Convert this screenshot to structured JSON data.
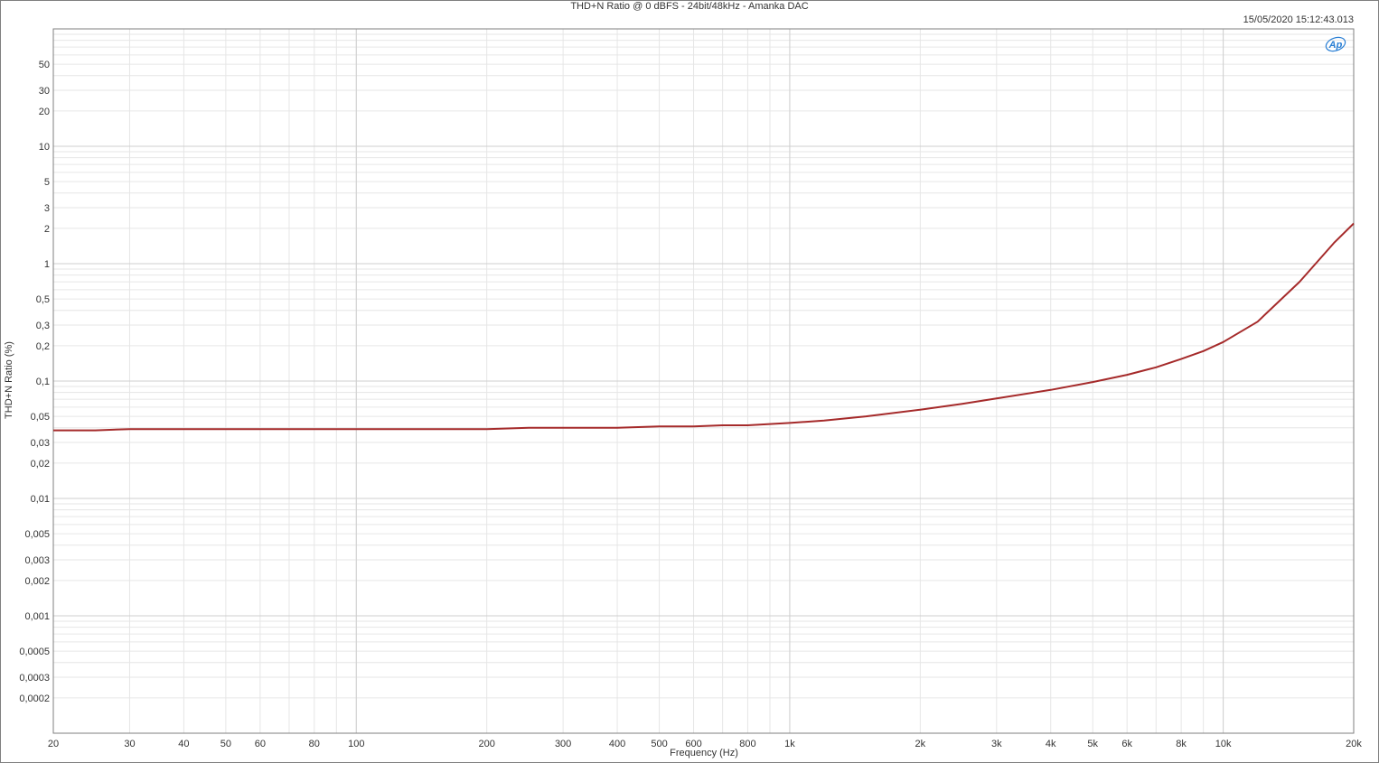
{
  "chart_data": {
    "type": "line",
    "title": "THD+N Ratio @ 0 dBFS - 24bit/48kHz - Amanka DAC",
    "timestamp": "15/05/2020 15:12:43.013",
    "logo": "AP",
    "xlabel": "Frequency (Hz)",
    "ylabel": "THD+N Ratio (%)",
    "x_scale": "log",
    "y_scale": "log",
    "xlim": [
      20,
      20000
    ],
    "ylim": [
      0.0001,
      100
    ],
    "grid": true,
    "x_ticks": [
      {
        "v": 20,
        "label": "20"
      },
      {
        "v": 30,
        "label": "30"
      },
      {
        "v": 40,
        "label": "40"
      },
      {
        "v": 50,
        "label": "50"
      },
      {
        "v": 60,
        "label": "60"
      },
      {
        "v": 80,
        "label": "80"
      },
      {
        "v": 100,
        "label": "100"
      },
      {
        "v": 200,
        "label": "200"
      },
      {
        "v": 300,
        "label": "300"
      },
      {
        "v": 400,
        "label": "400"
      },
      {
        "v": 500,
        "label": "500"
      },
      {
        "v": 600,
        "label": "600"
      },
      {
        "v": 800,
        "label": "800"
      },
      {
        "v": 1000,
        "label": "1k"
      },
      {
        "v": 2000,
        "label": "2k"
      },
      {
        "v": 3000,
        "label": "3k"
      },
      {
        "v": 4000,
        "label": "4k"
      },
      {
        "v": 5000,
        "label": "5k"
      },
      {
        "v": 6000,
        "label": "6k"
      },
      {
        "v": 8000,
        "label": "8k"
      },
      {
        "v": 10000,
        "label": "10k"
      },
      {
        "v": 20000,
        "label": "20k"
      }
    ],
    "y_ticks": [
      {
        "v": 50,
        "label": "50"
      },
      {
        "v": 30,
        "label": "30"
      },
      {
        "v": 20,
        "label": "20"
      },
      {
        "v": 10,
        "label": "10"
      },
      {
        "v": 5,
        "label": "5"
      },
      {
        "v": 3,
        "label": "3"
      },
      {
        "v": 2,
        "label": "2"
      },
      {
        "v": 1,
        "label": "1"
      },
      {
        "v": 0.5,
        "label": "0,5"
      },
      {
        "v": 0.3,
        "label": "0,3"
      },
      {
        "v": 0.2,
        "label": "0,2"
      },
      {
        "v": 0.1,
        "label": "0,1"
      },
      {
        "v": 0.05,
        "label": "0,05"
      },
      {
        "v": 0.03,
        "label": "0,03"
      },
      {
        "v": 0.02,
        "label": "0,02"
      },
      {
        "v": 0.01,
        "label": "0,01"
      },
      {
        "v": 0.005,
        "label": "0,005"
      },
      {
        "v": 0.003,
        "label": "0,003"
      },
      {
        "v": 0.002,
        "label": "0,002"
      },
      {
        "v": 0.001,
        "label": "0,001"
      },
      {
        "v": 0.0005,
        "label": "0,0005"
      },
      {
        "v": 0.0003,
        "label": "0,0003"
      },
      {
        "v": 0.0002,
        "label": "0,0002"
      }
    ],
    "series": [
      {
        "color": "#a52a2a",
        "x": [
          20,
          25,
          30,
          40,
          50,
          60,
          70,
          80,
          100,
          120,
          150,
          200,
          250,
          300,
          400,
          500,
          600,
          700,
          800,
          1000,
          1200,
          1500,
          2000,
          2500,
          3000,
          4000,
          5000,
          6000,
          7000,
          8000,
          9000,
          10000,
          12000,
          15000,
          18000,
          20000
        ],
        "y": [
          0.038,
          0.038,
          0.039,
          0.039,
          0.039,
          0.039,
          0.039,
          0.039,
          0.039,
          0.039,
          0.039,
          0.039,
          0.04,
          0.04,
          0.04,
          0.041,
          0.041,
          0.042,
          0.042,
          0.044,
          0.046,
          0.05,
          0.057,
          0.064,
          0.071,
          0.084,
          0.098,
          0.113,
          0.131,
          0.154,
          0.18,
          0.215,
          0.32,
          0.7,
          1.5,
          2.2
        ]
      }
    ]
  }
}
